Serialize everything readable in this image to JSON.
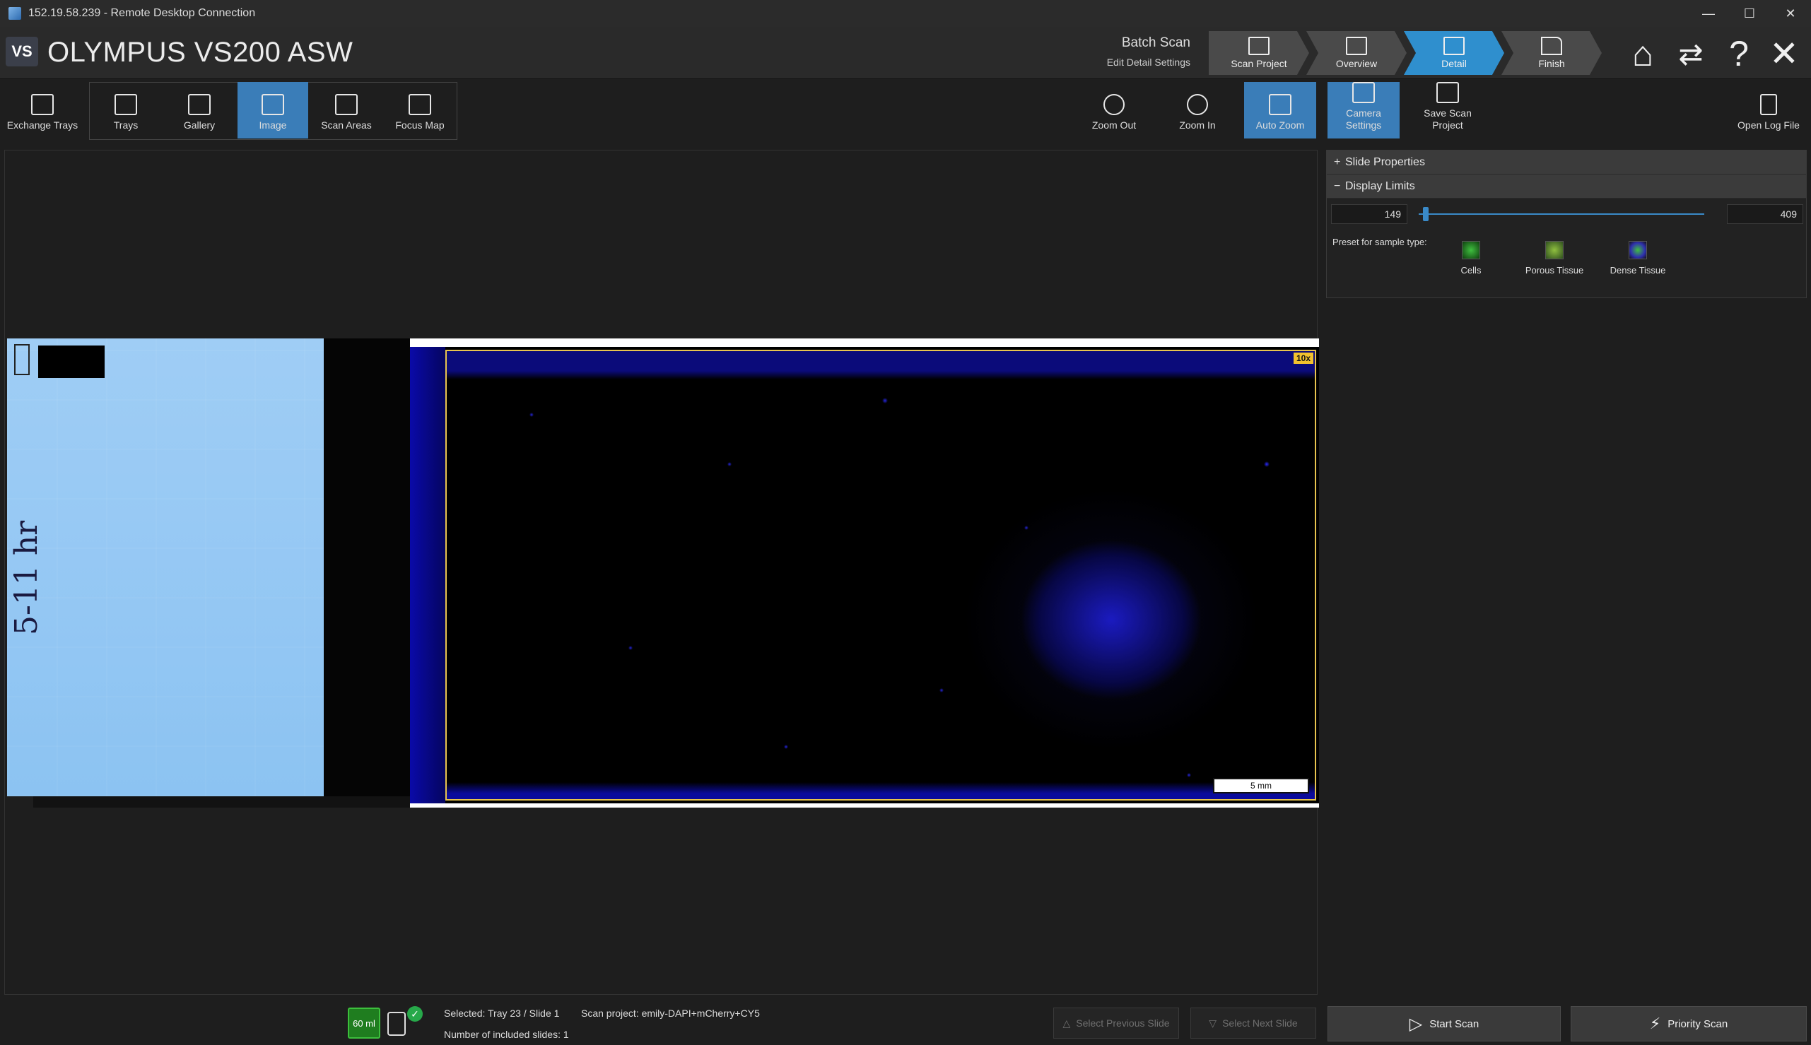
{
  "window": {
    "title": "152.19.58.239 - Remote Desktop Connection",
    "controls": {
      "minimize": "—",
      "maximize": "☐",
      "close": "✕"
    }
  },
  "header": {
    "logo": "VS",
    "app_title": "OLYMPUS VS200 ASW",
    "mode_title": "Batch Scan",
    "mode_sub": "Edit Detail Settings",
    "steps": [
      {
        "label": "Scan Project",
        "icon": "scan-project-icon"
      },
      {
        "label": "Overview",
        "icon": "overview-icon"
      },
      {
        "label": "Detail",
        "icon": "detail-icon",
        "active": true
      },
      {
        "label": "Finish",
        "icon": "finish-flag-icon"
      }
    ],
    "icons": {
      "home": "⌂",
      "swap": "⇄",
      "help": "?",
      "close": "✕"
    }
  },
  "toolbar": {
    "exchange_trays": "Exchange Trays",
    "trays": "Trays",
    "gallery": "Gallery",
    "image": "Image",
    "scan_areas": "Scan Areas",
    "focus_map": "Focus Map",
    "zoom_out": "Zoom Out",
    "zoom_in": "Zoom In",
    "auto_zoom": "Auto Zoom",
    "camera_settings": "Camera Settings",
    "save_scan_project": "Save Scan Project",
    "open_log_file": "Open Log File"
  },
  "viewer": {
    "label_handwriting": "5-11 hr",
    "magnification": "10x",
    "scale_bar": "5 mm"
  },
  "right_panel": {
    "slide_properties": "Slide Properties",
    "display_limits": "Display Limits",
    "plus": "+",
    "minus": "−",
    "min_value": "149",
    "max_value": "409",
    "preset_label": "Preset for sample type:",
    "presets": [
      "Cells",
      "Porous Tissue",
      "Dense Tissue"
    ]
  },
  "status": {
    "volume": "60 ml",
    "check": "✓",
    "selected": "Selected: Tray 23 / Slide 1",
    "included": "Number of included slides: 1",
    "scan_project": "Scan project: emily-DAPI+mCherry+CY5",
    "prev_slide": "Select Previous Slide",
    "next_slide": "Select Next Slide",
    "start_scan": "Start Scan",
    "priority_scan": "Priority Scan"
  },
  "colors": {
    "accent": "#2f8fce",
    "active_tool": "#3a7db8",
    "frame": "#e8c44e",
    "dapi_blue": "#2626e0"
  }
}
